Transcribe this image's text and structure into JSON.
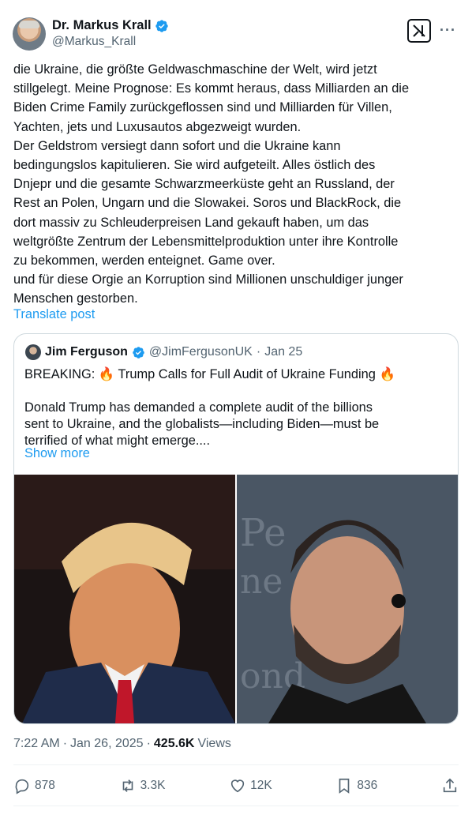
{
  "author": {
    "display_name": "Dr. Markus Krall",
    "handle": "@Markus_Krall",
    "verified": true
  },
  "header_actions": {
    "grok_icon": "grok-icon",
    "more_label": "···"
  },
  "post": {
    "text": "die Ukraine, die größte Geldwaschmaschine der Welt, wird jetzt\nstillgelegt. Meine Prognose: Es kommt heraus, dass Milliarden an die\nBiden Crime Family zurückgeflossen sind und Milliarden für Villen,\nYachten, jets und Luxusautos abgezweigt wurden.\nDer Geldstrom versiegt dann sofort und die Ukraine kann\nbedingungslos kapitulieren. Sie wird aufgeteilt. Alles östlich des\nDnjepr und die gesamte Schwarzmeerküste geht an Russland, der\nRest an Polen, Ungarn und die Slowakei. Soros und BlackRock, die\ndort massiv zu Schleuderpreisen Land gekauft haben, um das\nweltgrößte Zentrum der Lebensmittelproduktion unter ihre Kontrolle\nzu bekommen, werden enteignet. Game over.\nund für diese Orgie an Korruption sind Millionen unschuldiger junger\nMenschen gestorben.",
    "translate_label": "Translate post"
  },
  "quote": {
    "display_name": "Jim Ferguson",
    "handle": "@JimFergusonUK",
    "separator": "·",
    "date": "Jan 25",
    "text": "BREAKING: 🔥 Trump Calls for Full Audit of Ukraine Funding 🔥\n\nDonald Trump has demanded a complete audit of the billions\nsent to Ukraine, and the globalists—including Biden—must be\nterrified of what might emerge....",
    "show_more_label": "Show more"
  },
  "meta": {
    "time": "7:22 AM",
    "sep1": "·",
    "date": "Jan 26, 2025",
    "sep2": "·",
    "views_count": "425.6K",
    "views_label": "Views"
  },
  "actions": {
    "replies": "878",
    "reposts": "3.3K",
    "likes": "12K",
    "bookmarks": "836"
  },
  "colors": {
    "accent": "#1d9bf0",
    "secondary_text": "#536471",
    "border": "#cfd9de"
  }
}
